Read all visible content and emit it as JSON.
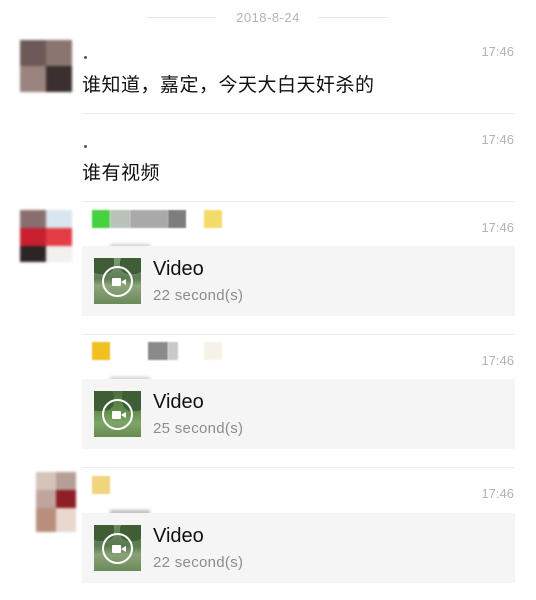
{
  "date_separator": "2018-8-24",
  "messages": [
    {
      "type": "text",
      "sender_mark": ".",
      "time": "17:46",
      "text": "谁知道，嘉定，今天大白天奸杀的"
    },
    {
      "type": "text",
      "sender_mark": ".",
      "time": "17:46",
      "text": "谁有视频"
    },
    {
      "type": "video",
      "time": "17:46",
      "video_label": "Video",
      "duration": "22 second(s)"
    },
    {
      "type": "video",
      "time": "17:46",
      "video_label": "Video",
      "duration": "25 second(s)"
    },
    {
      "type": "video",
      "time": "17:46",
      "video_label": "Video",
      "duration": "22 second(s)"
    }
  ],
  "icons": {
    "video_thumbnail_play": "video-camera-icon",
    "avatar": "pixelated-avatar"
  },
  "colors": {
    "background": "#ffffff",
    "card": "#f5f5f5",
    "time": "#b2b2b2",
    "divider": "#ececec",
    "duration": "#8c8c8c"
  }
}
